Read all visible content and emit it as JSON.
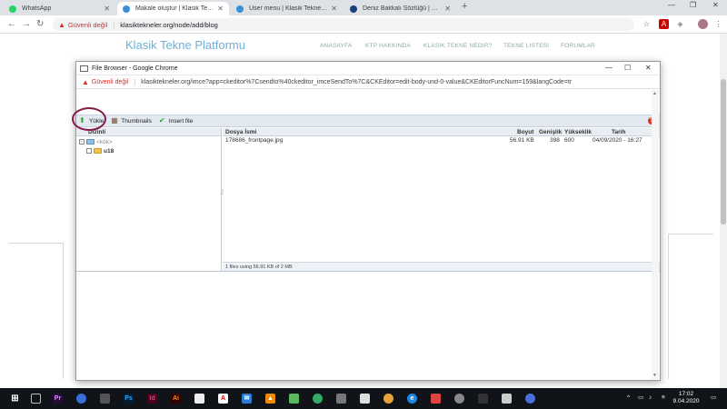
{
  "browser": {
    "tabs": [
      {
        "label": "WhatsApp",
        "icon": "whatsapp-icon",
        "color": "#25d366"
      },
      {
        "label": "Makale oluştur | Klasik Tekne Platf",
        "icon": "site-icon",
        "color": "#3a8fd8"
      },
      {
        "label": "User menu | Klasik Tekne Platform",
        "icon": "site-icon",
        "color": "#3a8fd8"
      },
      {
        "label": "Deniz Bakkalı Sözlüğü | Türkiye",
        "icon": "dictionary-icon",
        "color": "#1a3f7a"
      }
    ],
    "new_tab": "+",
    "insecure_label": "Güvenli değil",
    "url": "klasiktekneler.org/node/add/blog"
  },
  "site": {
    "logo": "Klasik Tekne Platformu",
    "nav": [
      "ANASAYFA",
      "KTP HAKKINDA",
      "KLASIK TEKNE NEDIR?",
      "TEKNE LISTESI",
      "FORUMLAR"
    ]
  },
  "popup": {
    "title": "File Browser - Google Chrome",
    "insecure_label": "Güvenli değil",
    "url": "klasiktekneler.org/imce?app=ckeditor%7Csendto%40ckeditor_imceSendTo%7C&CKEditor=edit-body-und-0-value&CKEditorFuncNum=159&langCode=tr",
    "toolbar": {
      "upload": "Yükle",
      "thumbnails": "Thumbnails",
      "insert": "Insert file",
      "help": "?"
    },
    "tree": {
      "header": "Dizinli",
      "root": "<kök>",
      "folder": "u18"
    },
    "columns": {
      "name": "Dosya İsmi",
      "size": "Boyut",
      "width": "Genişlik",
      "height": "Yükseklik",
      "date": "Tarih"
    },
    "files": [
      {
        "name": "178686_frontpage.jpg",
        "size": "56.91 KB",
        "width": "398",
        "height": "600",
        "date": "04/09/2020 - 16:27"
      }
    ],
    "status": "1 files using 56.91 KB of 2 MB"
  },
  "taskbar": {
    "apps": [
      "Pr",
      "Ps",
      "Id",
      "Ai"
    ],
    "time": "17:02",
    "date": "9.04.2020"
  }
}
